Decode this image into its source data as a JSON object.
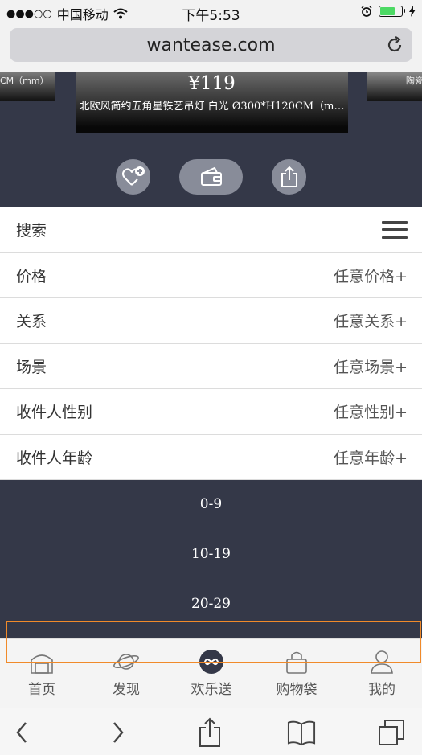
{
  "status_bar": {
    "signal": "●●●○○",
    "carrier": "中国移动",
    "time": "下午5:53"
  },
  "browser": {
    "url": "wantease.com"
  },
  "carousel": {
    "left_card_text": "CM（mm）",
    "main_price": "¥119",
    "main_name": "北欧风简约五角星铁艺吊灯 白光 Ø300*H120CM（m…",
    "right_card_text": "陶瓷"
  },
  "search": {
    "label": "搜索"
  },
  "filters": [
    {
      "label": "价格",
      "value": "任意价格+"
    },
    {
      "label": "关系",
      "value": "任意关系+"
    },
    {
      "label": "场景",
      "value": "任意场景+"
    },
    {
      "label": "收件人性别",
      "value": "任意性别+"
    },
    {
      "label": "收件人年龄",
      "value": "任意年龄+"
    }
  ],
  "age_options": [
    "0-9",
    "10-19",
    "20-29"
  ],
  "tabs": [
    {
      "label": "首页",
      "icon": "home-icon"
    },
    {
      "label": "发现",
      "icon": "planet-icon"
    },
    {
      "label": "欢乐送",
      "icon": "infinity-icon"
    },
    {
      "label": "购物袋",
      "icon": "bag-icon"
    },
    {
      "label": "我的",
      "icon": "user-icon"
    }
  ],
  "colors": {
    "dark_background": "#343848",
    "highlight": "#f08a2a",
    "battery": "#4cd964"
  }
}
